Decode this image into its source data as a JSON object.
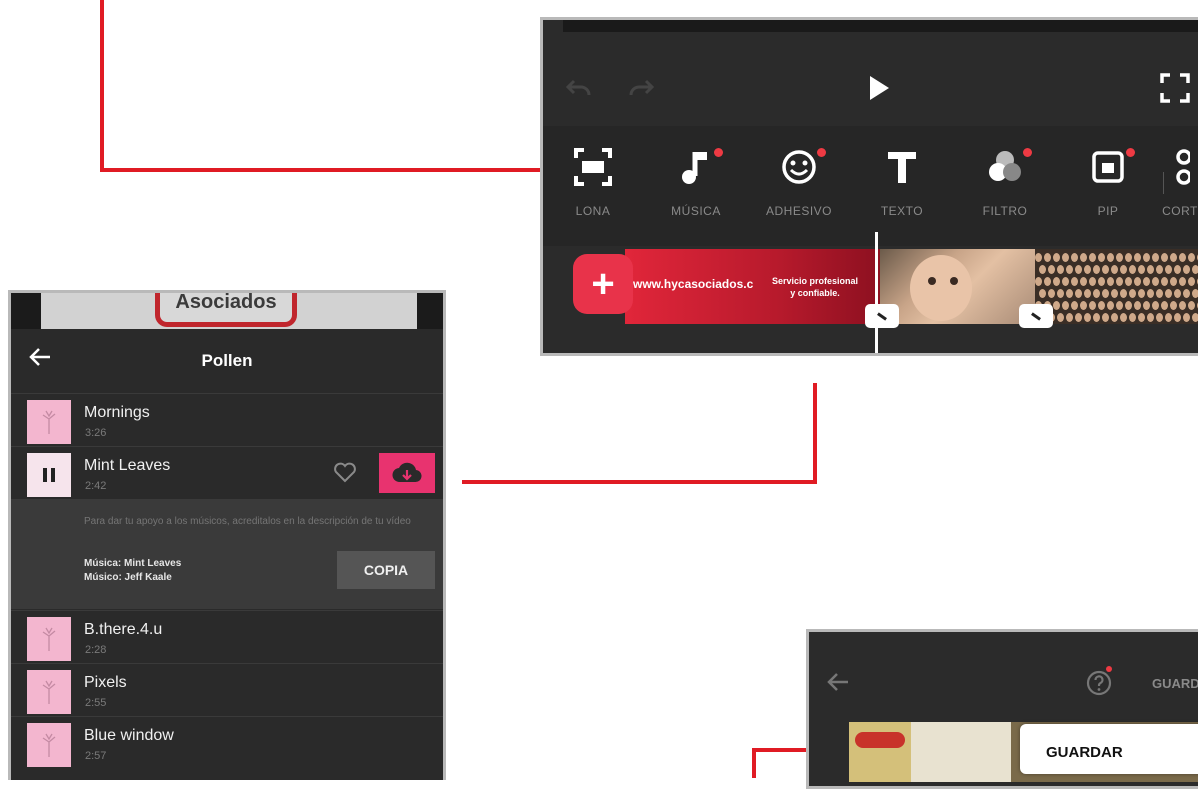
{
  "editor": {
    "tools": [
      {
        "label": "LONA",
        "icon": "canvas-icon",
        "dot": false
      },
      {
        "label": "MÚSICA",
        "icon": "music-note-icon",
        "dot": true
      },
      {
        "label": "ADHESIVO",
        "icon": "smiley-icon",
        "dot": true
      },
      {
        "label": "TEXTO",
        "icon": "text-icon",
        "dot": false
      },
      {
        "label": "FILTRO",
        "icon": "filter-icon",
        "dot": true
      },
      {
        "label": "PIP",
        "icon": "pip-icon",
        "dot": true
      },
      {
        "label": "CORT",
        "icon": "scissors-icon",
        "dot": false
      }
    ],
    "timeline": {
      "banner_url": "www.hycasociados.c",
      "banner_tagline_1": "Servicio profesional",
      "banner_tagline_2": "y confiable."
    }
  },
  "music": {
    "banner_text": "Asociados",
    "title": "Pollen",
    "tracks": [
      {
        "name": "Mornings",
        "duration": "3:26"
      },
      {
        "name": "Mint Leaves",
        "duration": "2:42"
      },
      {
        "name": "B.there.4.u",
        "duration": "2:28"
      },
      {
        "name": "Pixels",
        "duration": "2:55"
      },
      {
        "name": "Blue window",
        "duration": "2:57"
      }
    ],
    "credit": {
      "note": "Para dar tu apoyo a los músicos, acreditalos en la descripción de tu vídeo",
      "music_line": "Música: Mint Leaves",
      "musician_line": "Músico: Jeff Kaale",
      "copy_label": "COPIA"
    }
  },
  "save": {
    "top_label": "GUARD",
    "popup_label": "GUARDAR"
  },
  "colors": {
    "accent": "#e01b24",
    "pink": "#e8336f",
    "panel": "#2b2b2b"
  }
}
